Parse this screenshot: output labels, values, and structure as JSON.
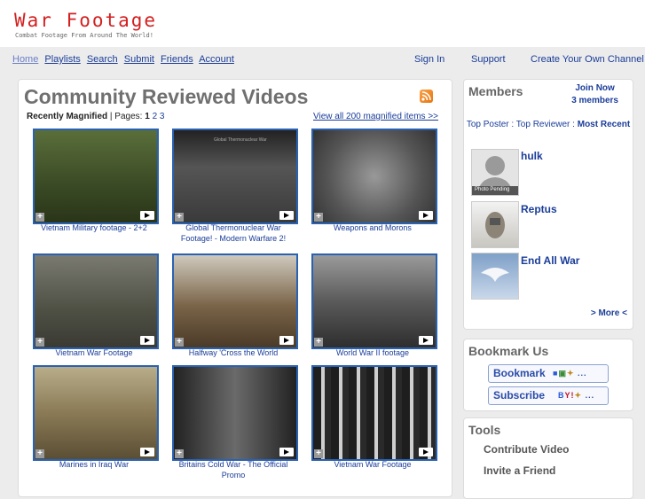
{
  "header": {
    "title": "War Footage",
    "tagline": "Combat Footage From Around The World!"
  },
  "nav": {
    "left": [
      "Home",
      "Playlists",
      "Search",
      "Submit",
      "Friends",
      "Account"
    ],
    "sign_in": "Sign In",
    "support": "Support",
    "create_channel": "Create Your Own Channel"
  },
  "main": {
    "title": "Community Reviewed Videos",
    "recently_label": "Recently Magnified",
    "pages_label": "| Pages:",
    "pages": [
      "1",
      "2",
      "3"
    ],
    "view_all": "View all 200 magnified items >>",
    "videos": [
      {
        "caption": "Vietnam Military footage - 2+2",
        "color": "#4a5a2f"
      },
      {
        "caption": "Global Thermonuclear War Footage! - Modern Warfare 2!",
        "color": "#3b3b3b"
      },
      {
        "caption": "Weapons and Morons",
        "color": "#6f6f6f"
      },
      {
        "caption": "Vietnam War Footage",
        "color": "#6a6a60"
      },
      {
        "caption": "Halfway 'Cross the World",
        "color": "#5e4a35"
      },
      {
        "caption": "World War II footage",
        "color": "#4a4a4a"
      },
      {
        "caption": "Marines in Iraq War",
        "color": "#8a7a55"
      },
      {
        "caption": "Britains Cold War - The Official Promo",
        "color": "#3a3a3a"
      },
      {
        "caption": "Vietnam War Footage",
        "color": "#2e2e2e"
      }
    ],
    "thumb_text": {
      "global": "Global Thermonuclear War",
      "photo_pending": "Photo Pending"
    }
  },
  "members": {
    "title": "Members",
    "join_now": "Join Now",
    "count": "3 members",
    "top_poster": "Top Poster",
    "separator": ":",
    "top_reviewer": "Top Reviewer",
    "most_recent": "Most Recent",
    "list": [
      "hulk",
      "Reptus",
      "End All War"
    ],
    "more": "> More <"
  },
  "bookmark": {
    "title": "Bookmark Us",
    "bookmark_label": "Bookmark",
    "subscribe_label": "Subscribe",
    "ellipsis": "..."
  },
  "tools": {
    "title": "Tools",
    "items": [
      "Contribute Video",
      "Invite a Friend"
    ]
  }
}
